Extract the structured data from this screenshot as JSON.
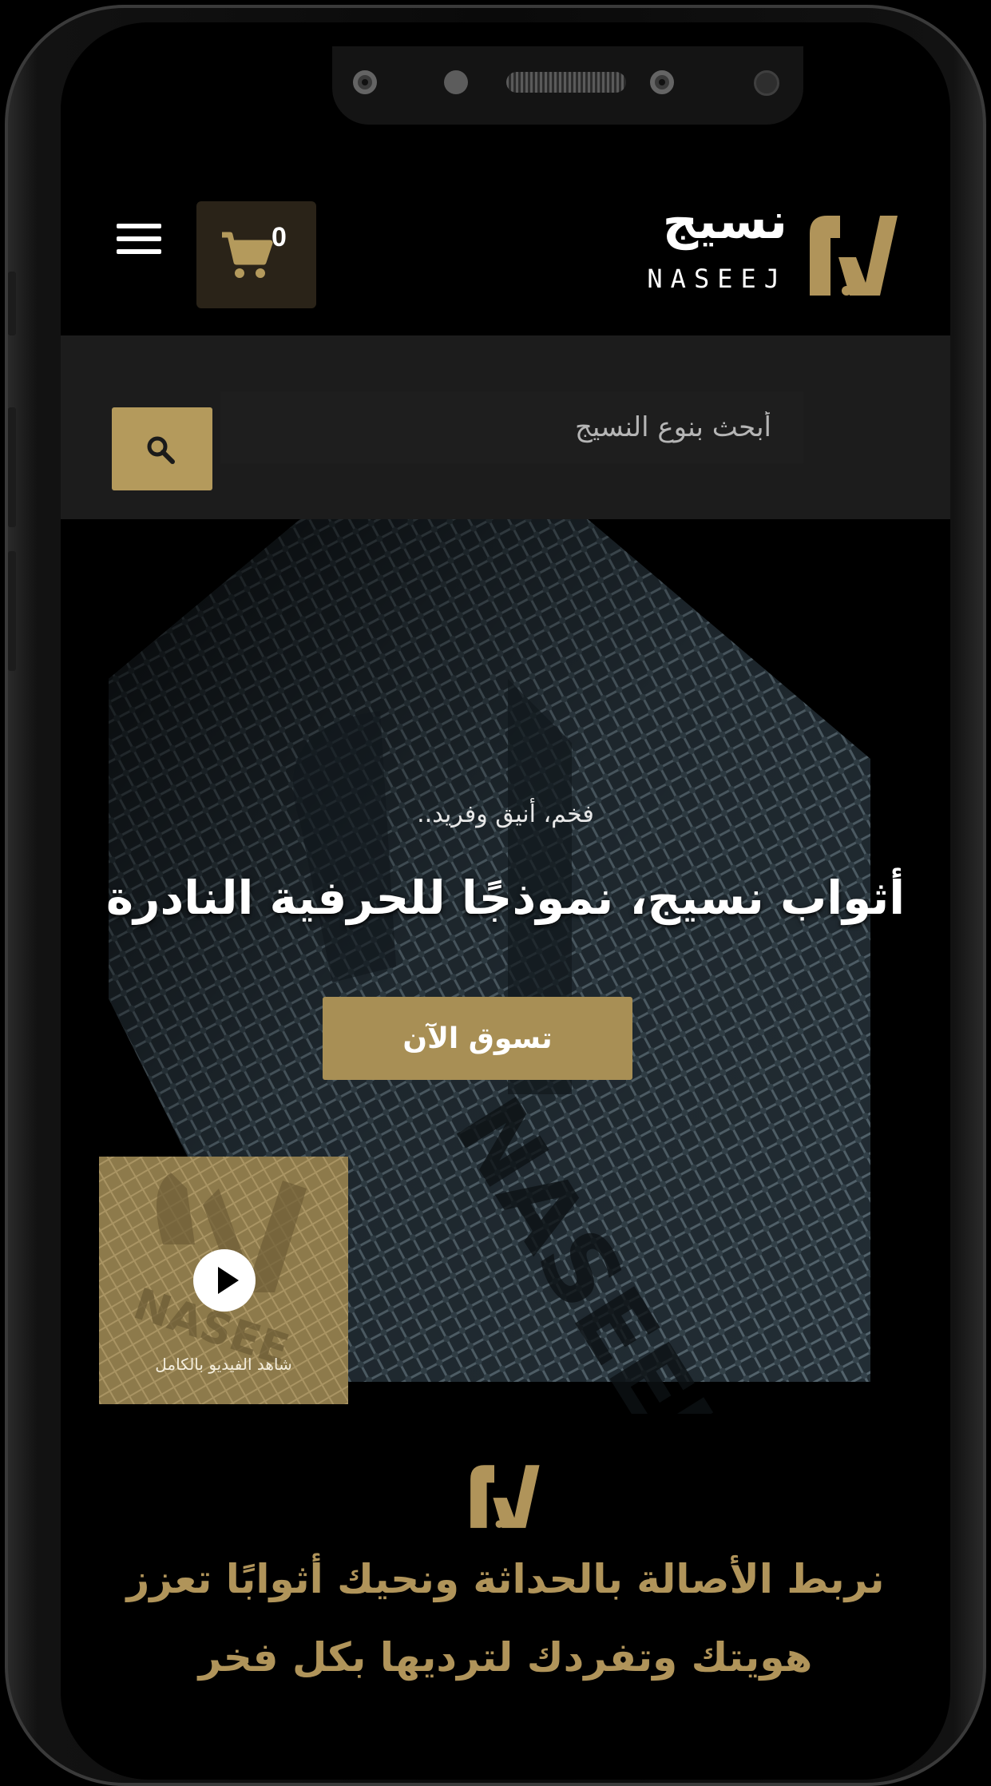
{
  "header": {
    "logo_arabic": "نسيج",
    "logo_latin": "NASEEJ",
    "cart_count": "0"
  },
  "search": {
    "placeholder": "أبحث بنوع النسيج"
  },
  "hero": {
    "tagline": "فخم، أنيق وفريد..",
    "title": "أثواب نسيج، نموذجًا للحرفية النادرة",
    "shop_button": "تسوق الآن",
    "video_caption": "شاهد الفيديو بالكامل"
  },
  "intro": {
    "slogan_line1": "نربط الأصالة بالحداثة ونحيك أثوابًا تعزز",
    "slogan_line2": "هويتك وتفردك لترديها بكل فخر"
  },
  "colors": {
    "gold": "#b49a5c",
    "background": "#000000",
    "search_band": "#1c1c1c"
  },
  "icons": [
    "menu-icon",
    "cart-icon",
    "search-icon",
    "play-icon",
    "brand-logo"
  ]
}
